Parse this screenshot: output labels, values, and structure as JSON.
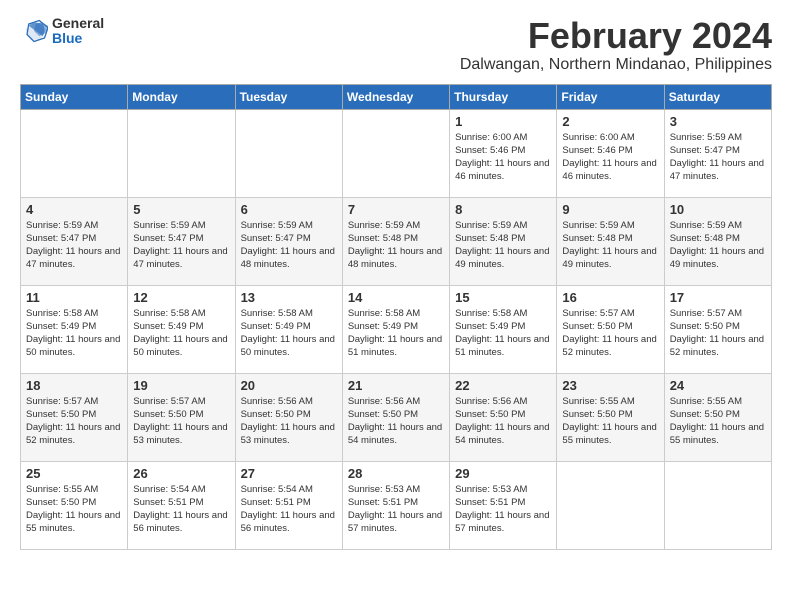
{
  "header": {
    "logo_general": "General",
    "logo_blue": "Blue",
    "title": "February 2024",
    "subtitle": "Dalwangan, Northern Mindanao, Philippines"
  },
  "days_of_week": [
    "Sunday",
    "Monday",
    "Tuesday",
    "Wednesday",
    "Thursday",
    "Friday",
    "Saturday"
  ],
  "weeks": [
    [
      {
        "day": "",
        "sunrise": "",
        "sunset": "",
        "daylight": ""
      },
      {
        "day": "",
        "sunrise": "",
        "sunset": "",
        "daylight": ""
      },
      {
        "day": "",
        "sunrise": "",
        "sunset": "",
        "daylight": ""
      },
      {
        "day": "",
        "sunrise": "",
        "sunset": "",
        "daylight": ""
      },
      {
        "day": "1",
        "sunrise": "Sunrise: 6:00 AM",
        "sunset": "Sunset: 5:46 PM",
        "daylight": "Daylight: 11 hours and 46 minutes."
      },
      {
        "day": "2",
        "sunrise": "Sunrise: 6:00 AM",
        "sunset": "Sunset: 5:46 PM",
        "daylight": "Daylight: 11 hours and 46 minutes."
      },
      {
        "day": "3",
        "sunrise": "Sunrise: 5:59 AM",
        "sunset": "Sunset: 5:47 PM",
        "daylight": "Daylight: 11 hours and 47 minutes."
      }
    ],
    [
      {
        "day": "4",
        "sunrise": "Sunrise: 5:59 AM",
        "sunset": "Sunset: 5:47 PM",
        "daylight": "Daylight: 11 hours and 47 minutes."
      },
      {
        "day": "5",
        "sunrise": "Sunrise: 5:59 AM",
        "sunset": "Sunset: 5:47 PM",
        "daylight": "Daylight: 11 hours and 47 minutes."
      },
      {
        "day": "6",
        "sunrise": "Sunrise: 5:59 AM",
        "sunset": "Sunset: 5:47 PM",
        "daylight": "Daylight: 11 hours and 48 minutes."
      },
      {
        "day": "7",
        "sunrise": "Sunrise: 5:59 AM",
        "sunset": "Sunset: 5:48 PM",
        "daylight": "Daylight: 11 hours and 48 minutes."
      },
      {
        "day": "8",
        "sunrise": "Sunrise: 5:59 AM",
        "sunset": "Sunset: 5:48 PM",
        "daylight": "Daylight: 11 hours and 49 minutes."
      },
      {
        "day": "9",
        "sunrise": "Sunrise: 5:59 AM",
        "sunset": "Sunset: 5:48 PM",
        "daylight": "Daylight: 11 hours and 49 minutes."
      },
      {
        "day": "10",
        "sunrise": "Sunrise: 5:59 AM",
        "sunset": "Sunset: 5:48 PM",
        "daylight": "Daylight: 11 hours and 49 minutes."
      }
    ],
    [
      {
        "day": "11",
        "sunrise": "Sunrise: 5:58 AM",
        "sunset": "Sunset: 5:49 PM",
        "daylight": "Daylight: 11 hours and 50 minutes."
      },
      {
        "day": "12",
        "sunrise": "Sunrise: 5:58 AM",
        "sunset": "Sunset: 5:49 PM",
        "daylight": "Daylight: 11 hours and 50 minutes."
      },
      {
        "day": "13",
        "sunrise": "Sunrise: 5:58 AM",
        "sunset": "Sunset: 5:49 PM",
        "daylight": "Daylight: 11 hours and 50 minutes."
      },
      {
        "day": "14",
        "sunrise": "Sunrise: 5:58 AM",
        "sunset": "Sunset: 5:49 PM",
        "daylight": "Daylight: 11 hours and 51 minutes."
      },
      {
        "day": "15",
        "sunrise": "Sunrise: 5:58 AM",
        "sunset": "Sunset: 5:49 PM",
        "daylight": "Daylight: 11 hours and 51 minutes."
      },
      {
        "day": "16",
        "sunrise": "Sunrise: 5:57 AM",
        "sunset": "Sunset: 5:50 PM",
        "daylight": "Daylight: 11 hours and 52 minutes."
      },
      {
        "day": "17",
        "sunrise": "Sunrise: 5:57 AM",
        "sunset": "Sunset: 5:50 PM",
        "daylight": "Daylight: 11 hours and 52 minutes."
      }
    ],
    [
      {
        "day": "18",
        "sunrise": "Sunrise: 5:57 AM",
        "sunset": "Sunset: 5:50 PM",
        "daylight": "Daylight: 11 hours and 52 minutes."
      },
      {
        "day": "19",
        "sunrise": "Sunrise: 5:57 AM",
        "sunset": "Sunset: 5:50 PM",
        "daylight": "Daylight: 11 hours and 53 minutes."
      },
      {
        "day": "20",
        "sunrise": "Sunrise: 5:56 AM",
        "sunset": "Sunset: 5:50 PM",
        "daylight": "Daylight: 11 hours and 53 minutes."
      },
      {
        "day": "21",
        "sunrise": "Sunrise: 5:56 AM",
        "sunset": "Sunset: 5:50 PM",
        "daylight": "Daylight: 11 hours and 54 minutes."
      },
      {
        "day": "22",
        "sunrise": "Sunrise: 5:56 AM",
        "sunset": "Sunset: 5:50 PM",
        "daylight": "Daylight: 11 hours and 54 minutes."
      },
      {
        "day": "23",
        "sunrise": "Sunrise: 5:55 AM",
        "sunset": "Sunset: 5:50 PM",
        "daylight": "Daylight: 11 hours and 55 minutes."
      },
      {
        "day": "24",
        "sunrise": "Sunrise: 5:55 AM",
        "sunset": "Sunset: 5:50 PM",
        "daylight": "Daylight: 11 hours and 55 minutes."
      }
    ],
    [
      {
        "day": "25",
        "sunrise": "Sunrise: 5:55 AM",
        "sunset": "Sunset: 5:50 PM",
        "daylight": "Daylight: 11 hours and 55 minutes."
      },
      {
        "day": "26",
        "sunrise": "Sunrise: 5:54 AM",
        "sunset": "Sunset: 5:51 PM",
        "daylight": "Daylight: 11 hours and 56 minutes."
      },
      {
        "day": "27",
        "sunrise": "Sunrise: 5:54 AM",
        "sunset": "Sunset: 5:51 PM",
        "daylight": "Daylight: 11 hours and 56 minutes."
      },
      {
        "day": "28",
        "sunrise": "Sunrise: 5:53 AM",
        "sunset": "Sunset: 5:51 PM",
        "daylight": "Daylight: 11 hours and 57 minutes."
      },
      {
        "day": "29",
        "sunrise": "Sunrise: 5:53 AM",
        "sunset": "Sunset: 5:51 PM",
        "daylight": "Daylight: 11 hours and 57 minutes."
      },
      {
        "day": "",
        "sunrise": "",
        "sunset": "",
        "daylight": ""
      },
      {
        "day": "",
        "sunrise": "",
        "sunset": "",
        "daylight": ""
      }
    ]
  ]
}
